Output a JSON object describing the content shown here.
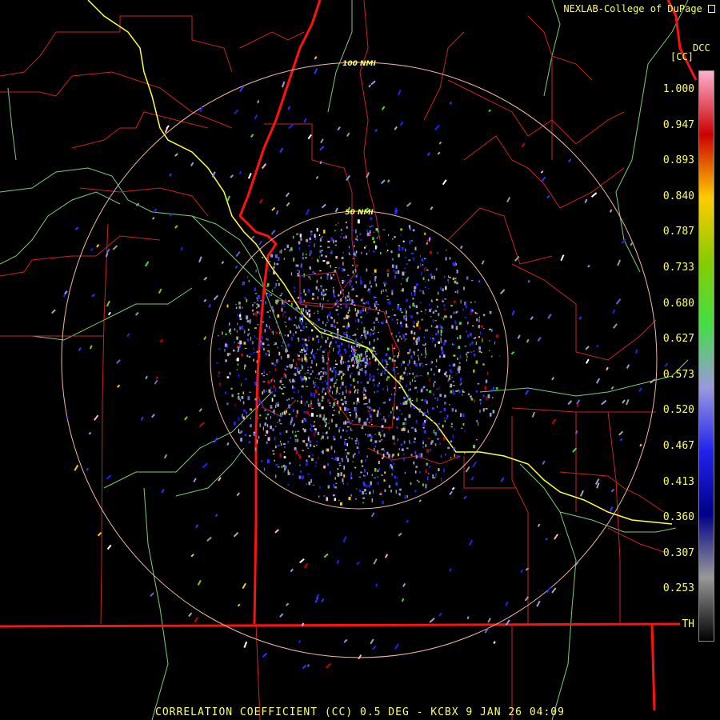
{
  "header": {
    "credit": "NEXLAB-College of DuPage",
    "product_code": "DCC",
    "units": "[CC]"
  },
  "footer": {
    "caption": "CORRELATION COEFFICIENT (CC) 0.5 DEG - KCBX 9 JAN 26 04:09"
  },
  "range_rings": [
    {
      "label": "100 NMI"
    },
    {
      "label": "50 NMI"
    }
  ],
  "legend": {
    "ticks": [
      "1.000",
      "0.947",
      "0.893",
      "0.840",
      "0.787",
      "0.733",
      "0.680",
      "0.627",
      "0.573",
      "0.520",
      "0.467",
      "0.413",
      "0.360",
      "0.307",
      "0.253",
      "TH"
    ],
    "color_stops": [
      {
        "value": "1.000",
        "color": "#ffb0d0"
      },
      {
        "value": "0.947",
        "color": "#cc0000"
      },
      {
        "value": "0.893",
        "color": "#ffcc00"
      },
      {
        "value": "0.840",
        "color": "#88cc00"
      },
      {
        "value": "0.787",
        "color": "#44dd44"
      },
      {
        "value": "0.733",
        "color": "#9999dd"
      },
      {
        "value": "0.680",
        "color": "#2222ee"
      },
      {
        "value": "0.413",
        "color": "#000088"
      },
      {
        "value": "0.360",
        "color": "#999999"
      },
      {
        "value": "TH",
        "color": "#000000"
      }
    ]
  },
  "colors": {
    "background": "#000000",
    "text": "#ffff66",
    "county_lines": "#cc2222",
    "state_lines": "#ff1111",
    "rivers": "#7acc7a",
    "highway": "#ffff44",
    "range_rings": "#f0b8a8"
  }
}
